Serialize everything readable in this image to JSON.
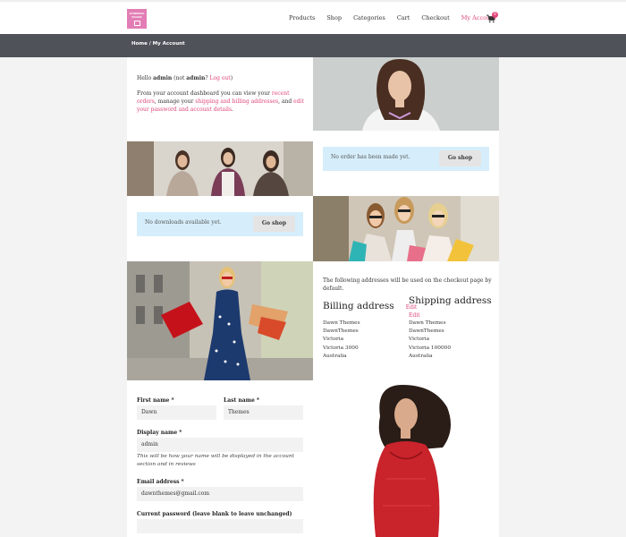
{
  "colors": {
    "accent": "#e0457b",
    "bar": "#4f5259",
    "notice": "#d6eefb",
    "logo": "#e37db5"
  },
  "header": {
    "logo_line1": "ECOMMERCE",
    "logo_line2": "BUILDER",
    "nav": [
      "Products",
      "Shop",
      "Categories",
      "Cart",
      "Checkout",
      "My Account"
    ],
    "cart_icon": "shopping-cart-icon",
    "cart_count": "0"
  },
  "breadcrumb": "Home / My Account",
  "dashboard": {
    "hello_prefix": "Hello ",
    "user": "admin",
    "not_prefix": " (not ",
    "not_user": "admin",
    "not_suffix": "? ",
    "logout": "Log out",
    "close": ")",
    "intro": "From your account dashboard you can view your ",
    "recent_orders": "recent orders",
    "manage": ", manage your ",
    "addresses_link": "shipping and billing addresses",
    "and": ", and ",
    "password_link": "edit your password and account details",
    "end": "."
  },
  "orders": {
    "message": "No order has been made yet.",
    "button": "Go shop"
  },
  "downloads": {
    "message": "No downloads available yet.",
    "button": "Go shop"
  },
  "addresses": {
    "intro": "The following addresses will be used on the checkout page by default.",
    "billing_title": "Billing address",
    "billing_edit": "Edit",
    "billing_lines": [
      "Dawn Themes",
      "DawnThemes",
      "Victoria",
      "Victoria 3000",
      "Australia"
    ],
    "shipping_title": "Shipping address",
    "shipping_edit": "Edit",
    "shipping_lines": [
      "Dawn Themes",
      "DawnThemes",
      "Victoria",
      "Victoria 100000",
      "Australia"
    ]
  },
  "account_form": {
    "first_name_label": "First name *",
    "first_name_value": "Dawn",
    "last_name_label": "Last name *",
    "last_name_value": "Themes",
    "display_label": "Display name *",
    "display_value": "admin",
    "display_hint": "This will be how your name will be displayed in the account section and in reviews",
    "email_label": "Email address *",
    "email_value": "dawnthemes@gmail.com",
    "password_label": "Current password (leave blank to leave unchanged)"
  }
}
